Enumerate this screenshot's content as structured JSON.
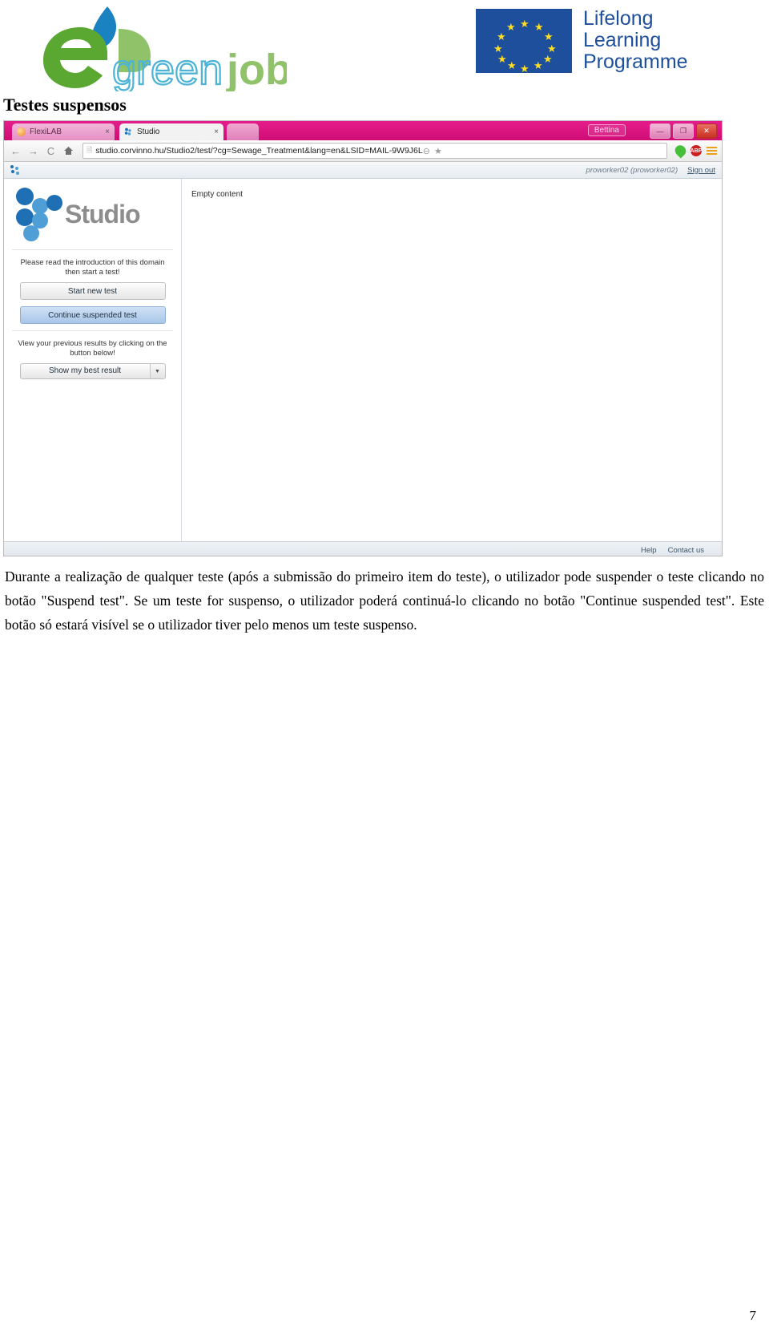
{
  "logos": {
    "egreenjobs": {
      "alt": "eGreenjobs logo",
      "text_green": "green",
      "text_jobs": "jobs"
    },
    "llp": {
      "line1": "Lifelong",
      "line2": "Learning",
      "line3": "Programme",
      "flag_alt": "European Union flag",
      "color": "#1d4f9c"
    }
  },
  "page": {
    "heading": "Testes suspensos",
    "number": "7"
  },
  "browser": {
    "window_title": "Bettina",
    "window_controls": {
      "minimize": "—",
      "maximize": "❐",
      "close": "✕"
    },
    "tabs": [
      {
        "label": "FlexiLAB",
        "close": "×",
        "active": false,
        "favicon": "flexilab-favicon"
      },
      {
        "label": "Studio",
        "close": "×",
        "active": true,
        "favicon": "studio-favicon"
      }
    ],
    "new_tab_label": "",
    "nav": {
      "back": "←",
      "forward": "→",
      "reload": "C",
      "home": "⌂",
      "page_icon": "page-icon",
      "url_prefix": "studio.corvinno.hu",
      "url_path": "/Studio2/test/?cg=Sewage_Treatment&lang=en&LSID=MAIL-9W9J6L",
      "url_full": "studio.corvinno.hu/Studio2/test/?cg=Sewage_Treatment&lang=en&LSID=MAIL-9W9J6L",
      "zoom_icon": "⊖",
      "bookmark_icon": "★",
      "ext_green": "green-pin-extension-icon",
      "ext_abp": "ABP",
      "ext_menu": "menu-icon"
    }
  },
  "app": {
    "user": "proworker02 (proworker02)",
    "sign_out": "Sign out",
    "logo_word": "Studio",
    "empty_content": "Empty content",
    "panel": {
      "intro_note": "Please read the introduction of this domain then start a test!",
      "start_button": "Start new test",
      "continue_button": "Continue suspended test",
      "results_note": "View your previous results by clicking on the button below!",
      "results_button": "Show my best result",
      "results_arrow": "▼"
    },
    "footer": {
      "help": "Help",
      "contact": "Contact us"
    }
  },
  "body_text": {
    "paragraph": "Durante a realização de qualquer teste (após a submissão do primeiro item do teste), o utilizador pode suspender o teste clicando no botão \"Suspend test\". Se um teste for suspenso, o utilizador poderá continuá-lo clicando no botão \"Continue suspended test\". Este botão só estará visível se o utilizador tiver pelo menos um teste suspenso."
  },
  "colors": {
    "browser_chrome": "#e0107f",
    "llp_blue": "#1d4f9c",
    "eu_star": "#ffdd22",
    "studio_grey": "#8d8d8d",
    "green_dark": "#5aa832",
    "green_light": "#8fc269",
    "blue_leaf": "#1b82c2"
  }
}
